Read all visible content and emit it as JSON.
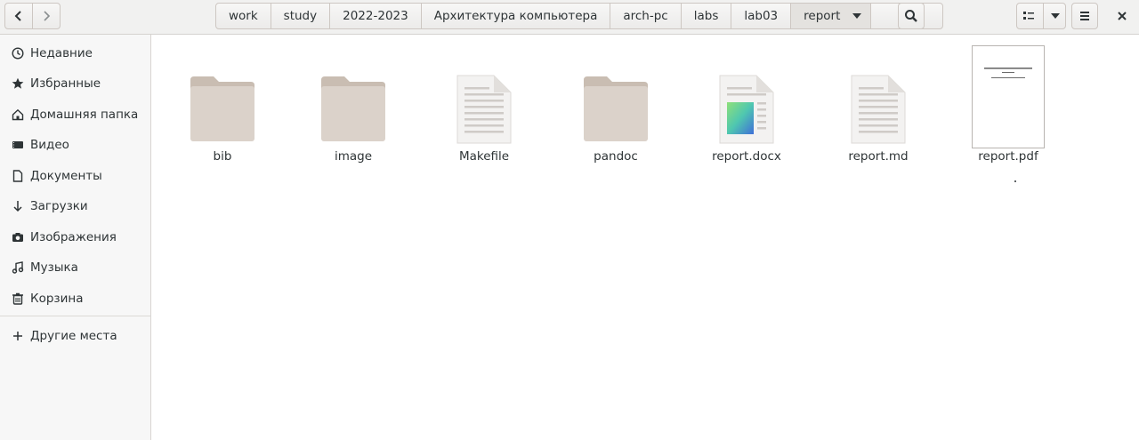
{
  "header": {
    "back_icon": "chevron-left-icon",
    "forward_icon": "chevron-right-icon",
    "breadcrumbs": [
      "work",
      "study",
      "2022-2023",
      "Архитектура компьютера",
      "arch-pc",
      "labs",
      "lab03",
      "report"
    ],
    "search_icon": "search-icon",
    "view_icon": "list-view-icon",
    "view_menu_icon": "chevron-down-icon",
    "menu_icon": "hamburger-icon",
    "close_icon": "close-icon"
  },
  "sidebar": {
    "items": [
      {
        "label": "Недавние",
        "icon": "clock-icon"
      },
      {
        "label": "Избранные",
        "icon": "star-icon"
      },
      {
        "label": "Домашняя папка",
        "icon": "home-icon"
      },
      {
        "label": "Видео",
        "icon": "video-icon"
      },
      {
        "label": "Документы",
        "icon": "document-icon"
      },
      {
        "label": "Загрузки",
        "icon": "download-icon"
      },
      {
        "label": "Изображения",
        "icon": "camera-icon"
      },
      {
        "label": "Музыка",
        "icon": "music-icon"
      },
      {
        "label": "Корзина",
        "icon": "trash-icon"
      }
    ],
    "other_places": {
      "label": "Другие места",
      "icon": "plus-icon"
    }
  },
  "files": [
    {
      "name": "bib",
      "type": "folder"
    },
    {
      "name": "image",
      "type": "folder"
    },
    {
      "name": "Makefile",
      "type": "text"
    },
    {
      "name": "pandoc",
      "type": "folder"
    },
    {
      "name": "report.docx",
      "type": "docx"
    },
    {
      "name": "report.md",
      "type": "text"
    },
    {
      "name": "report.pdf",
      "type": "pdf"
    }
  ],
  "colors": {
    "folder": "#d9cfc7",
    "folder_tab": "#c9bdb2",
    "accent": "#3584e4"
  }
}
